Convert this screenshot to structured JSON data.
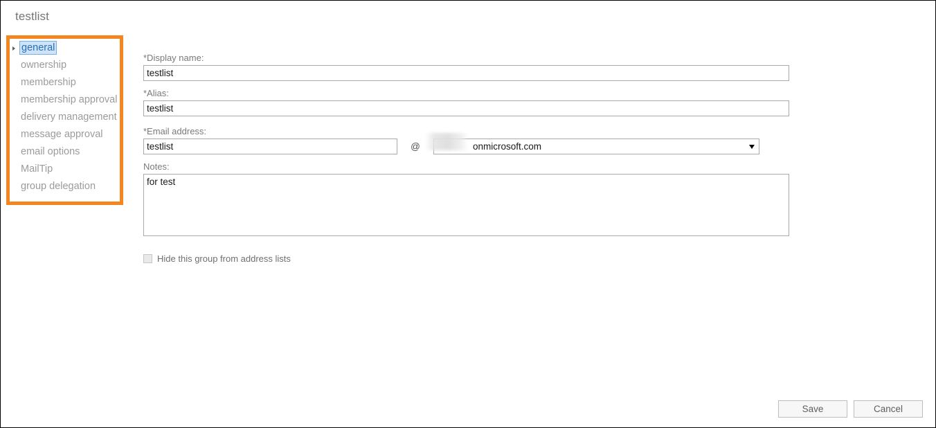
{
  "page": {
    "title": "testlist"
  },
  "sidebar": {
    "items": [
      {
        "label": "general",
        "selected": true
      },
      {
        "label": "ownership",
        "selected": false
      },
      {
        "label": "membership",
        "selected": false
      },
      {
        "label": "membership approval",
        "selected": false
      },
      {
        "label": "delivery management",
        "selected": false
      },
      {
        "label": "message approval",
        "selected": false
      },
      {
        "label": "email options",
        "selected": false
      },
      {
        "label": "MailTip",
        "selected": false
      },
      {
        "label": "group delegation",
        "selected": false
      }
    ]
  },
  "form": {
    "display_name": {
      "label": "*Display name:",
      "value": "testlist",
      "placeholder": ""
    },
    "alias": {
      "label": "*Alias:",
      "value": "testlist",
      "placeholder": ""
    },
    "email_address": {
      "label": "*Email address:",
      "local_value": "testlist",
      "local_placeholder": "",
      "at_symbol": "@",
      "domain_value": "onmicrosoft.com",
      "domain_redacted": true
    },
    "notes": {
      "label": "Notes:",
      "value": "for test",
      "placeholder": ""
    },
    "hide_group": {
      "label": "Hide this group from address lists",
      "checked": false
    }
  },
  "footer": {
    "save_label": "Save",
    "cancel_label": "Cancel"
  },
  "annotation": {
    "highlight_color": "#f5851f"
  },
  "colors": {
    "selected_nav_text": "#2a6fb5",
    "selected_nav_bg": "#cde3f7",
    "nav_text": "#9b9b9b",
    "label_text": "#7a7a7a",
    "border": "#a9a9a9",
    "highlight_orange": "#f5851f"
  },
  "icons": {
    "nav_caret": "triangle-right-icon",
    "dropdown_arrow": "chevron-down-icon"
  }
}
